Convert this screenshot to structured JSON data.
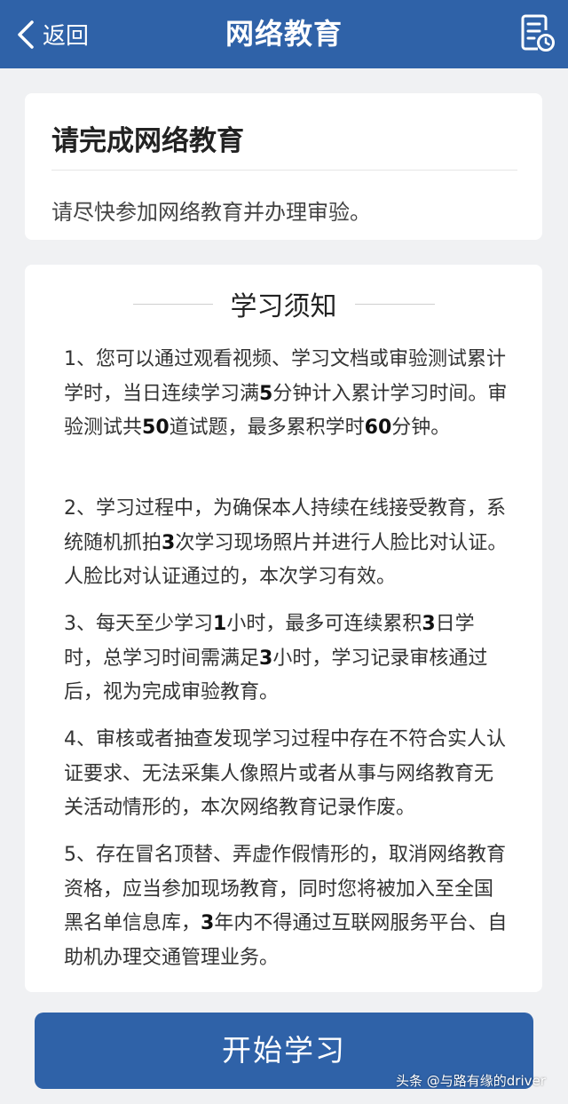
{
  "nav": {
    "back_label": "返回",
    "title": "网络教育",
    "back_icon": "chevron-left-icon",
    "record_icon": "document-clock-icon"
  },
  "notice": {
    "title": "请完成网络教育",
    "body": "请尽快参加网络教育并办理审验。"
  },
  "rules": {
    "title": "学习须知",
    "items": [
      {
        "parts": [
          {
            "t": "1、您可以通过观看视频、学习文档或审验测试累计学时，当日连续学习满"
          },
          {
            "t": "5",
            "b": true
          },
          {
            "t": "分钟计入累计学习时间。审验测试共"
          },
          {
            "t": "50",
            "b": true
          },
          {
            "t": "道试题，最多累积学时"
          },
          {
            "t": "60",
            "b": true
          },
          {
            "t": "分钟。"
          }
        ]
      },
      {
        "parts": [
          {
            "t": "2、学习过程中，为确保本人持续在线接受教育，系统随机抓拍"
          },
          {
            "t": "3",
            "b": true
          },
          {
            "t": "次学习现场照片并进行人脸比对认证。人脸比对认证通过的，本次学习有效。"
          }
        ]
      },
      {
        "parts": [
          {
            "t": "3、每天至少学习"
          },
          {
            "t": "1",
            "b": true
          },
          {
            "t": "小时，最多可连续累积"
          },
          {
            "t": "3",
            "b": true
          },
          {
            "t": "日学时，总学习时间需满足"
          },
          {
            "t": "3",
            "b": true
          },
          {
            "t": "小时，学习记录审核通过后，视为完成审验教育。"
          }
        ]
      },
      {
        "parts": [
          {
            "t": "4、审核或者抽查发现学习过程中存在不符合实人认证要求、无法采集人像照片或者从事与网络教育无关活动情形的，本次网络教育记录作废。"
          }
        ]
      },
      {
        "parts": [
          {
            "t": "5、存在冒名顶替、弄虚作假情形的，取消网络教育资格，应当参加现场教育，同时您将被加入至全国黑名单信息库，"
          },
          {
            "t": "3",
            "b": true
          },
          {
            "t": "年内不得通过互联网服务平台、自助机办理交通管理业务。"
          }
        ]
      }
    ]
  },
  "start_button": "开始学习",
  "watermark": "头条 @与路有缘的driver",
  "colors": {
    "primary": "#2f62a8",
    "background": "#f0f1f3"
  }
}
